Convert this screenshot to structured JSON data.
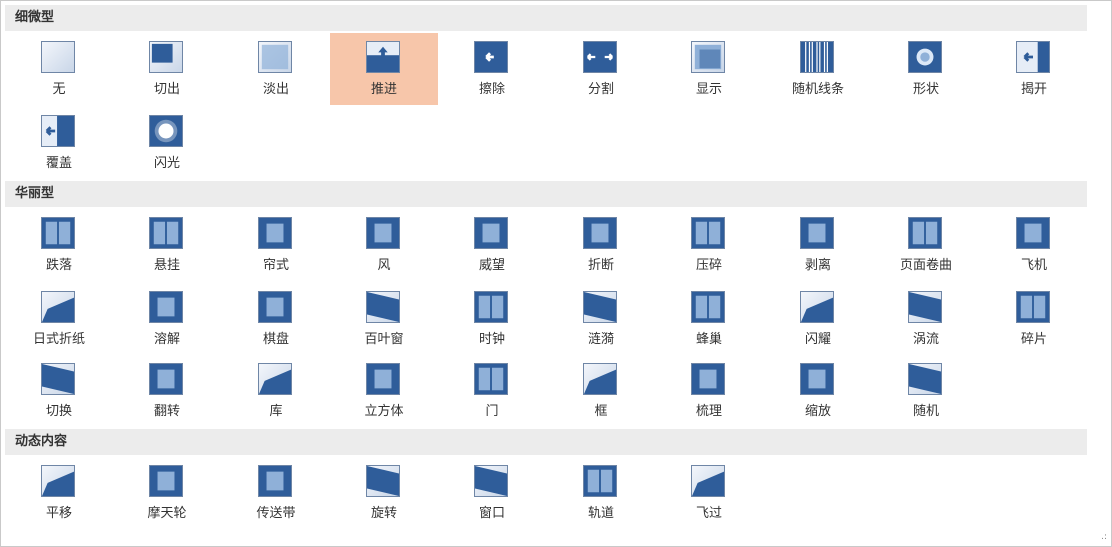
{
  "sections": [
    {
      "title": "细微型",
      "rows": [
        [
          "无",
          "切出",
          "淡出",
          "推进",
          "擦除",
          "分割",
          "显示",
          "随机线条",
          "形状",
          "揭开"
        ],
        [
          "覆盖",
          "闪光"
        ]
      ]
    },
    {
      "title": "华丽型",
      "rows": [
        [
          "跌落",
          "悬挂",
          "帘式",
          "风",
          "威望",
          "折断",
          "压碎",
          "剥离",
          "页面卷曲",
          "飞机"
        ],
        [
          "日式折纸",
          "溶解",
          "棋盘",
          "百叶窗",
          "时钟",
          "涟漪",
          "蜂巢",
          "闪耀",
          "涡流",
          "碎片"
        ],
        [
          "切换",
          "翻转",
          "库",
          "立方体",
          "门",
          "框",
          "梳理",
          "缩放",
          "随机"
        ]
      ]
    },
    {
      "title": "动态内容",
      "rows": [
        [
          "平移",
          "摩天轮",
          "传送带",
          "旋转",
          "窗口",
          "轨道",
          "飞过"
        ]
      ]
    }
  ],
  "selected": "推进",
  "icons": {
    "无": "none-icon",
    "切出": "cut-icon",
    "淡出": "fade-icon",
    "推进": "push-icon",
    "擦除": "wipe-icon",
    "分割": "split-icon",
    "显示": "reveal-icon",
    "随机线条": "random-bars-icon",
    "形状": "shape-icon",
    "揭开": "uncover-icon",
    "覆盖": "cover-icon",
    "闪光": "flash-icon",
    "跌落": "fall-over-icon",
    "悬挂": "drape-icon",
    "帘式": "curtains-icon",
    "风": "wind-icon",
    "威望": "prestige-icon",
    "折断": "fracture-icon",
    "压碎": "crush-icon",
    "剥离": "peel-off-icon",
    "页面卷曲": "page-curl-icon",
    "飞机": "airplane-icon",
    "日式折纸": "origami-icon",
    "溶解": "dissolve-icon",
    "棋盘": "checkerboard-icon",
    "百叶窗": "blinds-icon",
    "时钟": "clock-icon",
    "涟漪": "ripple-icon",
    "蜂巢": "honeycomb-icon",
    "闪耀": "glitter-icon",
    "涡流": "vortex-icon",
    "碎片": "shred-icon",
    "切换": "switch-icon",
    "翻转": "flip-icon",
    "库": "gallery-icon",
    "立方体": "cube-icon",
    "门": "doors-icon",
    "框": "box-icon",
    "梳理": "comb-icon",
    "缩放": "zoom-icon",
    "随机": "random-icon",
    "平移": "pan-icon",
    "摩天轮": "ferris-wheel-icon",
    "传送带": "conveyor-icon",
    "旋转": "rotate-icon",
    "窗口": "window-icon",
    "轨道": "orbit-icon",
    "飞过": "fly-through-icon"
  }
}
